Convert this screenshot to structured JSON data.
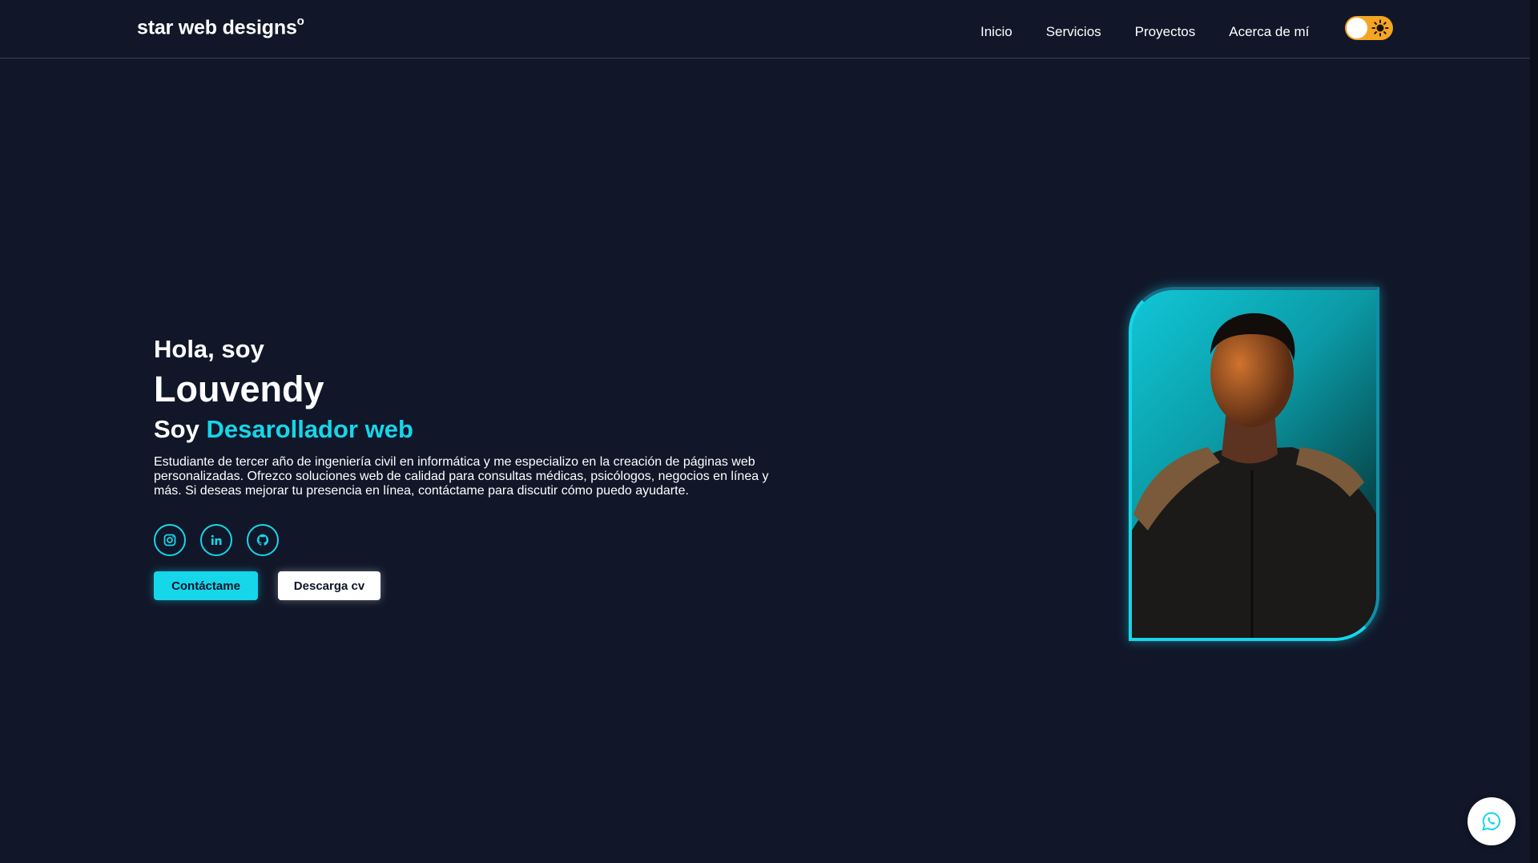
{
  "header": {
    "logo": "star web designs",
    "logo_mark": "o",
    "nav": [
      "Inicio",
      "Servicios",
      "Proyectos",
      "Acerca de mí"
    ],
    "theme_toggle_icon": "sun-icon"
  },
  "hero": {
    "greeting": "Hola, soy",
    "name": "Louvendy",
    "role_prefix": "Soy",
    "role_highlight": "Desarollador web",
    "description": "Estudiante de tercer año de ingeniería civil en informática y me especializo en la creación de páginas web personalizadas. Ofrezco soluciones web de calidad para consultas médicas, psicólogos, negocios en línea y más. Si deseas mejorar tu presencia en línea, contáctame para discutir cómo puedo ayudarte.",
    "socials": [
      "instagram-icon",
      "linkedin-icon",
      "github-icon"
    ],
    "btn_contact": "Contáctame",
    "btn_cv": "Descarga cv"
  },
  "colors": {
    "background": "#111729",
    "accent": "#16d6ea",
    "toggle": "#f5a524"
  },
  "floating": {
    "icon": "whatsapp-icon"
  }
}
